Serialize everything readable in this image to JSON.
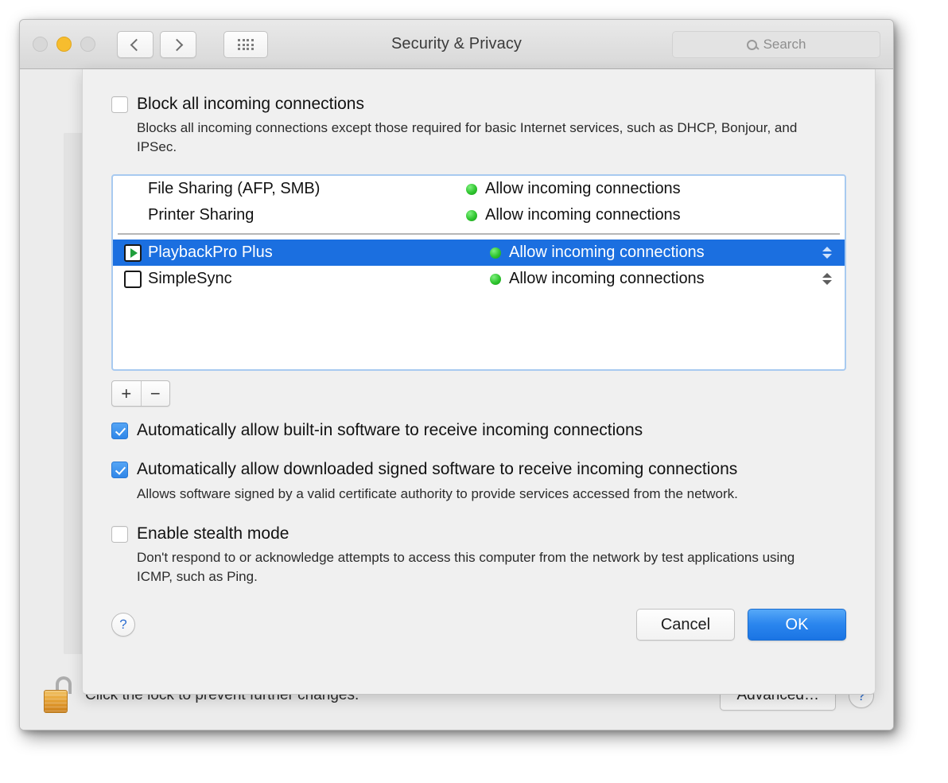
{
  "window": {
    "title": "Security & Privacy",
    "traffic_lights": [
      "close",
      "minimize",
      "zoom"
    ],
    "nav": {
      "back": "‹",
      "forward": "›",
      "grid": "show-all"
    },
    "search": {
      "placeholder": "Search",
      "value": ""
    }
  },
  "sheet": {
    "block_all": {
      "label": "Block all incoming connections",
      "checked": false,
      "description": "Blocks all incoming connections except those required for basic Internet services,  such as DHCP, Bonjour, and IPSec."
    },
    "list": {
      "system_rows": [
        {
          "name": "File Sharing (AFP, SMB)",
          "status": "Allow incoming connections",
          "status_color": "#2fc52f",
          "icon": "none",
          "selected": false,
          "stepper": false
        },
        {
          "name": "Printer Sharing",
          "status": "Allow incoming connections",
          "status_color": "#2fc52f",
          "icon": "none",
          "selected": false,
          "stepper": false
        }
      ],
      "app_rows": [
        {
          "name": "PlaybackPro Plus",
          "status": "Allow incoming connections",
          "status_color": "#2fc52f",
          "icon": "play-app-icon",
          "selected": true,
          "stepper": true
        },
        {
          "name": "SimpleSync",
          "status": "Allow incoming connections",
          "status_color": "#2fc52f",
          "icon": "sync-app-icon",
          "selected": false,
          "stepper": true
        }
      ]
    },
    "add_remove": {
      "add": "+",
      "remove": "−"
    },
    "auto_builtin": {
      "label": "Automatically allow built-in software to receive incoming connections",
      "checked": true
    },
    "auto_signed": {
      "label": "Automatically allow downloaded signed software to receive incoming connections",
      "checked": true,
      "description": "Allows software signed by a valid certificate authority to provide services accessed from the network."
    },
    "stealth": {
      "label": "Enable stealth mode",
      "checked": false,
      "description": "Don't respond to or acknowledge attempts to access this computer from the network by test applications using ICMP, such as Ping."
    },
    "footer": {
      "help": "?",
      "cancel": "Cancel",
      "ok": "OK"
    }
  },
  "lockbar": {
    "lock_state": "unlocked",
    "message": "Click the lock to prevent further changes.",
    "advanced": "Advanced…",
    "help": "?"
  },
  "colors": {
    "accent_blue": "#1b6fe0",
    "ok_blue": "#2b86ee",
    "status_green": "#2fc52f",
    "selection_text": "#ffffff",
    "lock_gold": "#e8a93f"
  }
}
